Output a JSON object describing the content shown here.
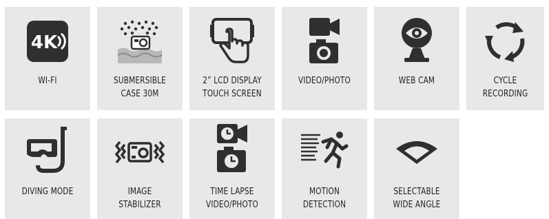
{
  "features": [
    {
      "icon": "4k-wifi-icon",
      "label1": "WI-FI",
      "label2": ""
    },
    {
      "icon": "waterproof-case-icon",
      "label1": "SUBMERSIBLE",
      "label2": "CASE 30M"
    },
    {
      "icon": "touch-screen-icon",
      "label1": "2” LCD DISPLAY",
      "label2": "TOUCH SCREEN"
    },
    {
      "icon": "video-photo-icon",
      "label1": "VIDEO/PHOTO",
      "label2": ""
    },
    {
      "icon": "web-cam-icon",
      "label1": "WEB CAM",
      "label2": ""
    },
    {
      "icon": "cycle-recording-icon",
      "label1": "CYCLE",
      "label2": "RECORDING"
    },
    {
      "icon": "diving-mask-icon",
      "label1": "DIVING MODE",
      "label2": ""
    },
    {
      "icon": "image-stabilizer-icon",
      "label1": "IMAGE",
      "label2": "STABILIZER"
    },
    {
      "icon": "time-lapse-icon",
      "label1": "TIME LAPSE",
      "label2": "VIDEO/PHOTO"
    },
    {
      "icon": "motion-detection-icon",
      "label1": "MOTION",
      "label2": "DETECTION"
    },
    {
      "icon": "wide-angle-icon",
      "label1": "SELECTABLE",
      "label2": "WIDE ANGLE"
    }
  ],
  "badge_text": "4K",
  "colors": {
    "tile": "#e8e8e8",
    "icon": "#2f2f2f",
    "water": "#b8b8b8"
  }
}
